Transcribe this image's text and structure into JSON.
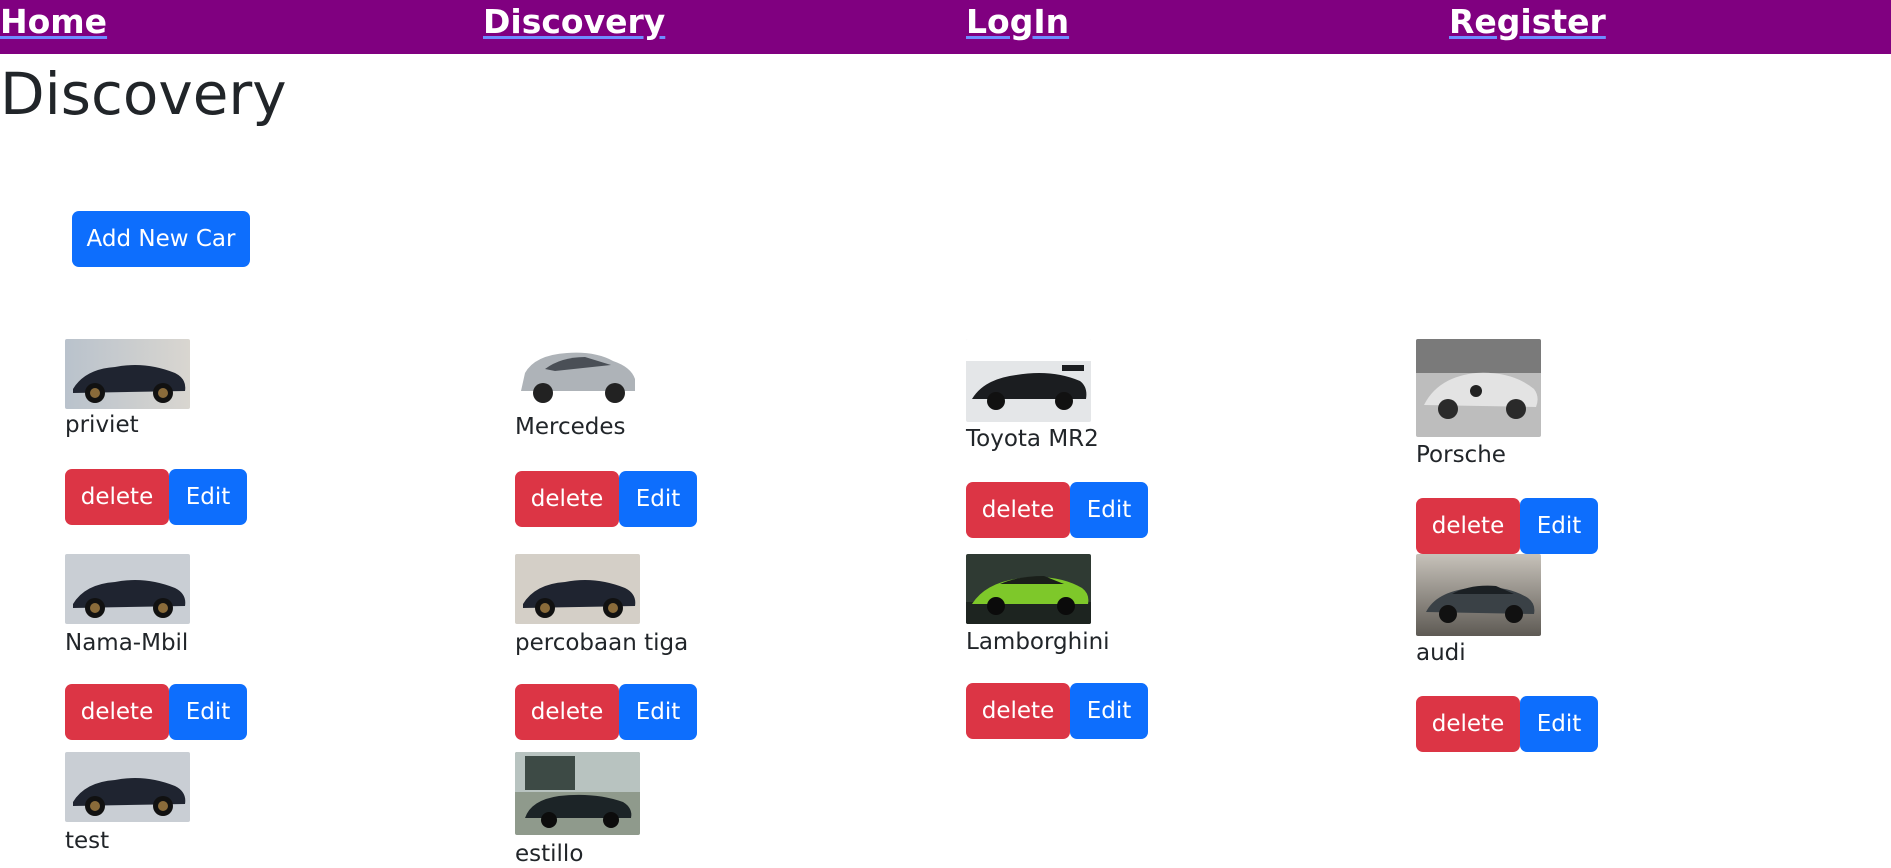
{
  "nav": {
    "home": "Home",
    "discovery": "Discovery",
    "login": "LogIn",
    "register": "Register"
  },
  "page": {
    "title": "Discovery",
    "add_button": "Add New Car"
  },
  "cars": [
    {
      "name": "priviet",
      "image": "black-hypercar"
    },
    {
      "name": "Mercedes",
      "image": "silver-suv"
    },
    {
      "name": "Toyota MR2",
      "image": "black-sports-car"
    },
    {
      "name": "Porsche",
      "image": "vintage-racing-car"
    },
    {
      "name": "Nama-Mbil",
      "image": "black-hypercar"
    },
    {
      "name": "percobaan tiga",
      "image": "black-hypercar"
    },
    {
      "name": "Lamborghini",
      "image": "green-supercar"
    },
    {
      "name": "audi",
      "image": "grey-sedan"
    },
    {
      "name": "test",
      "image": "black-hypercar"
    },
    {
      "name": "estillo",
      "image": "dark-hatchback"
    }
  ],
  "actions": {
    "delete": "delete",
    "edit": "Edit"
  },
  "colors": {
    "navbar": "#800080",
    "primary": "#0d6efd",
    "danger": "#dc3545"
  }
}
